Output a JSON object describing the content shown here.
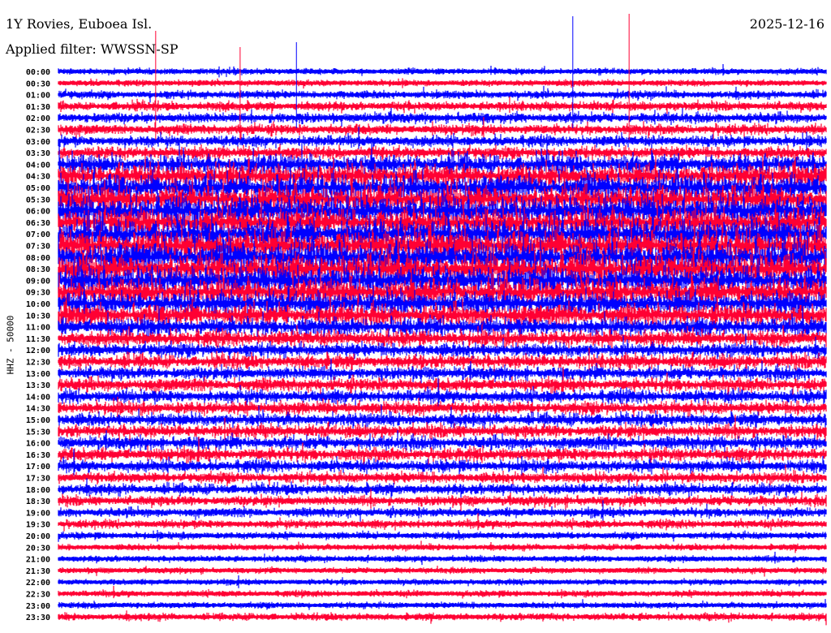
{
  "header": {
    "station": "1Y Rovies, Euboea Isl.",
    "filter": "Applied filter: WWSSN-SP",
    "date": "2025-12-16"
  },
  "chart_data": {
    "type": "line",
    "title": "1Y Rovies, Euboea Isl.",
    "ylabel": "HHZ - 50000",
    "minutes_per_line": 30,
    "colors": [
      "#0000ff",
      "#ff0033"
    ],
    "trace_labels": [
      "00:00",
      "00:30",
      "01:00",
      "01:30",
      "02:00",
      "02:30",
      "03:00",
      "03:30",
      "04:00",
      "04:30",
      "05:00",
      "05:30",
      "06:00",
      "06:30",
      "07:00",
      "07:30",
      "08:00",
      "08:30",
      "09:00",
      "09:30",
      "10:00",
      "10:30",
      "11:00",
      "11:30",
      "12:00",
      "12:30",
      "13:00",
      "13:30",
      "14:00",
      "14:30",
      "15:00",
      "15:30",
      "16:00",
      "16:30",
      "17:00",
      "17:30",
      "18:00",
      "18:30",
      "19:00",
      "19:30",
      "20:00",
      "20:30",
      "21:00",
      "21:30",
      "22:00",
      "22:30",
      "23:00",
      "23:30"
    ],
    "relative_amplitude": [
      4,
      4,
      6,
      7,
      8,
      8,
      9,
      10,
      18,
      22,
      25,
      27,
      28,
      28,
      29,
      30,
      30,
      29,
      28,
      26,
      22,
      20,
      16,
      14,
      12,
      12,
      11,
      11,
      11,
      11,
      11,
      11,
      11,
      11,
      10,
      9,
      9,
      8,
      7,
      6,
      5,
      4,
      4,
      3.5,
      3.5,
      4,
      4,
      5
    ],
    "spikes": [
      {
        "trace": "00:30",
        "minute": 3.8,
        "color": "#ff0033"
      },
      {
        "trace": "00:30",
        "minute": 7.1,
        "color": "#ff0033"
      },
      {
        "trace": "00:00",
        "minute": 9.3,
        "color": "#0000ff"
      },
      {
        "trace": "00:00",
        "minute": 20.1,
        "color": "#0000ff"
      },
      {
        "trace": "00:30",
        "minute": 22.3,
        "color": "#ff0033"
      }
    ]
  }
}
